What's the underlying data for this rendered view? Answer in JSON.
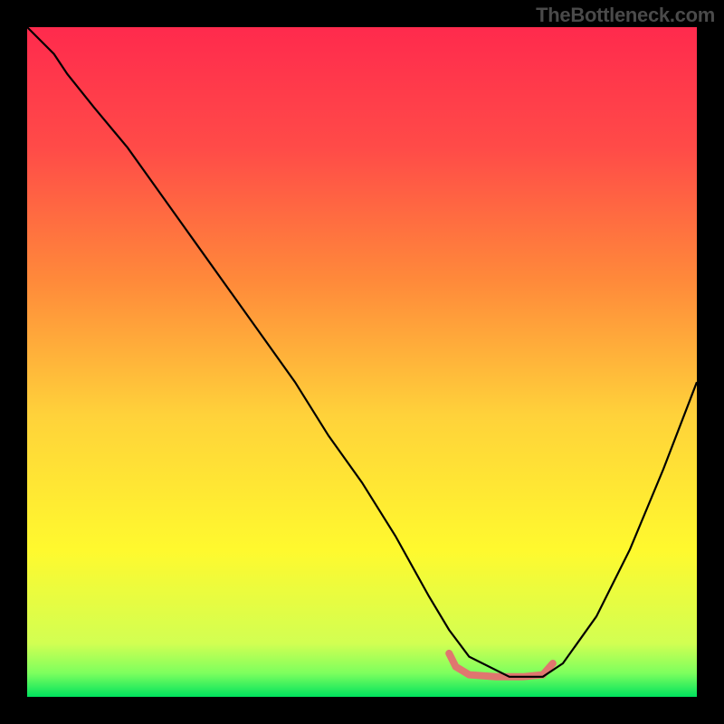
{
  "watermark": "TheBottleneck.com",
  "chart_data": {
    "type": "line",
    "title": "",
    "xlabel": "",
    "ylabel": "",
    "xlim": [
      0,
      100
    ],
    "ylim": [
      0,
      100
    ],
    "grid": false,
    "legend": false,
    "background_gradient": {
      "direction": "vertical",
      "stops": [
        {
          "pos": 0.0,
          "color": "#ff2a4d"
        },
        {
          "pos": 0.18,
          "color": "#ff4b48"
        },
        {
          "pos": 0.38,
          "color": "#ff8a3a"
        },
        {
          "pos": 0.58,
          "color": "#ffd23a"
        },
        {
          "pos": 0.78,
          "color": "#fff92e"
        },
        {
          "pos": 0.92,
          "color": "#d2ff52"
        },
        {
          "pos": 0.965,
          "color": "#7cff5e"
        },
        {
          "pos": 1.0,
          "color": "#00e25e"
        }
      ]
    },
    "series": [
      {
        "name": "main-curve",
        "color": "#000000",
        "x": [
          0,
          4,
          6,
          10,
          15,
          20,
          25,
          30,
          35,
          40,
          45,
          50,
          55,
          60,
          63,
          66,
          72,
          77,
          80,
          85,
          90,
          95,
          100
        ],
        "y": [
          100,
          96,
          93,
          88,
          82,
          75,
          68,
          61,
          54,
          47,
          39,
          32,
          24,
          15,
          10,
          6,
          3,
          3,
          5,
          12,
          22,
          34,
          47
        ]
      },
      {
        "name": "highlight-segment",
        "color": "#e0766f",
        "thickness": 8,
        "x": [
          63,
          64,
          66,
          70,
          74,
          77,
          78.5
        ],
        "y": [
          6.5,
          4.5,
          3.3,
          3.0,
          3.0,
          3.3,
          5.0
        ]
      }
    ]
  }
}
